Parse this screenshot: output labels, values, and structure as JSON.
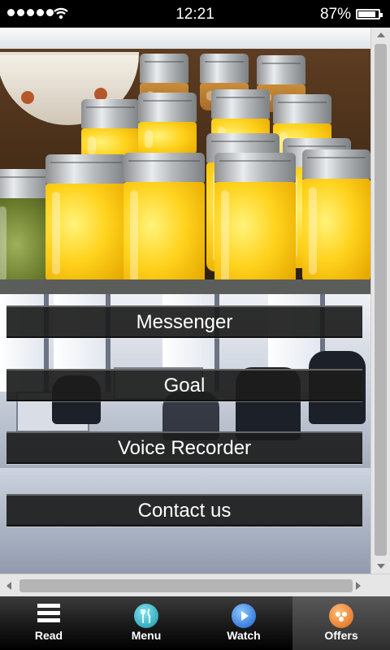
{
  "status_bar": {
    "time": "12:21",
    "battery": "87%",
    "battery_level": 0.87
  },
  "menu_buttons": [
    "Messenger",
    "Goal",
    "Voice Recorder",
    "Contact us"
  ],
  "tabs": [
    {
      "label": "Read",
      "icon": "menu-lines-icon"
    },
    {
      "label": "Menu",
      "icon": "cutlery-icon"
    },
    {
      "label": "Watch",
      "icon": "play-icon"
    },
    {
      "label": "Offers",
      "icon": "dots-icon"
    }
  ],
  "colors": {
    "tab_bar": "#1b1b1b",
    "button_bg": "#1c1c1c",
    "jar_fill": "#ffd21c"
  }
}
